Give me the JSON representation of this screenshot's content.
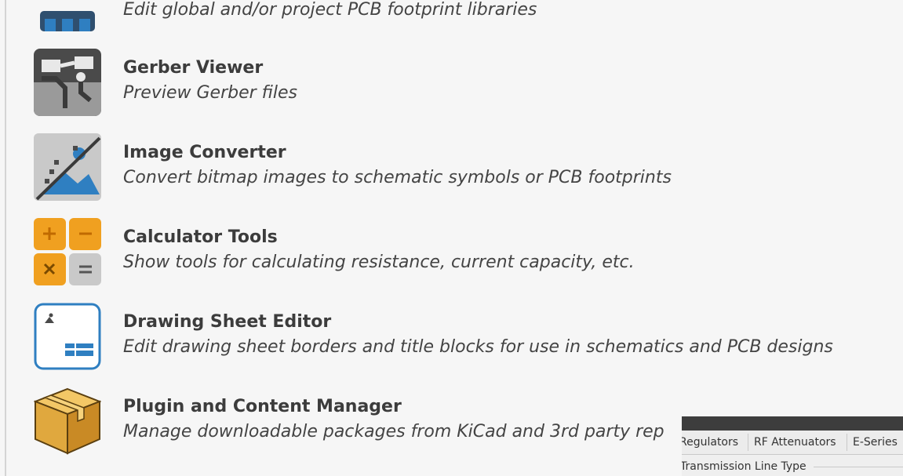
{
  "tools": [
    {
      "icon": "footprint-library-icon",
      "title": "",
      "description": "Edit global and/or project PCB footprint libraries"
    },
    {
      "icon": "gerber-viewer-icon",
      "title": "Gerber Viewer",
      "description": "Preview Gerber files"
    },
    {
      "icon": "image-converter-icon",
      "title": "Image Converter",
      "description": "Convert bitmap images to schematic symbols or PCB footprints"
    },
    {
      "icon": "calculator-icon",
      "title": "Calculator Tools",
      "description": "Show tools for calculating resistance, current capacity, etc."
    },
    {
      "icon": "drawing-sheet-icon",
      "title": "Drawing Sheet Editor",
      "description": "Edit drawing sheet borders and title blocks for use in schematics and PCB designs"
    },
    {
      "icon": "package-box-icon",
      "title": "Plugin and Content Manager",
      "description": "Manage downloadable packages from KiCad and 3rd party rep"
    }
  ],
  "calculator_window": {
    "tabs": [
      "Regulators",
      "RF Attenuators",
      "E-Series"
    ],
    "group_label": "Transmission Line Type"
  },
  "colors": {
    "panel_bg": "#f6f6f6",
    "title_text": "#3c3c3c",
    "calc_orange": "#f0a020",
    "icon_blue": "#2f7fc1",
    "titlebar_dark": "#3d3d3d"
  }
}
